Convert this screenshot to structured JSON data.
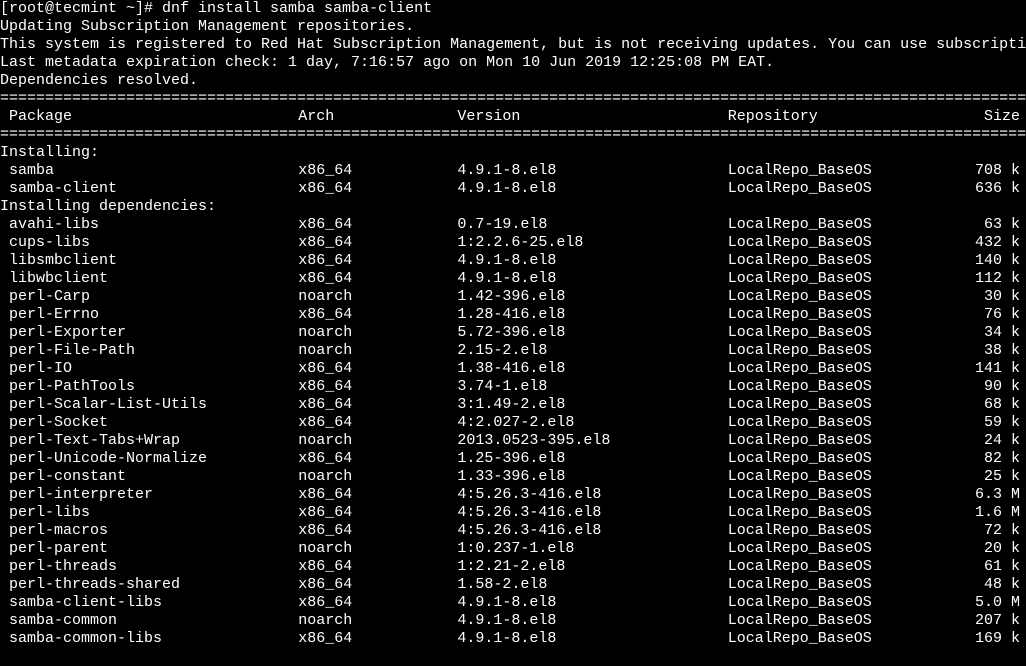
{
  "prompt_prefix": "[root@tecmint ~]# ",
  "command": "dnf install samba samba-client",
  "messages": [
    "Updating Subscription Management repositories.",
    "This system is registered to Red Hat Subscription Management, but is not receiving updates. You can use subscription-manager to assign subscriptions.",
    "Last metadata expiration check: 1 day, 7:16:57 ago on Mon 10 Jun 2019 12:25:08 PM EAT.",
    "Dependencies resolved."
  ],
  "ruler": "==================================================================================================================",
  "headers": {
    "package": " Package",
    "arch": "Arch",
    "version": "Version",
    "repository": "Repository",
    "size": "Size"
  },
  "sections": [
    {
      "title": "Installing:",
      "rows": [
        {
          "pkg": " samba",
          "arch": "x86_64",
          "ver": "4.9.1-8.el8",
          "repo": "LocalRepo_BaseOS",
          "size": "708 k"
        },
        {
          "pkg": " samba-client",
          "arch": "x86_64",
          "ver": "4.9.1-8.el8",
          "repo": "LocalRepo_BaseOS",
          "size": "636 k"
        }
      ]
    },
    {
      "title": "Installing dependencies:",
      "rows": [
        {
          "pkg": " avahi-libs",
          "arch": "x86_64",
          "ver": "0.7-19.el8",
          "repo": "LocalRepo_BaseOS",
          "size": "63 k"
        },
        {
          "pkg": " cups-libs",
          "arch": "x86_64",
          "ver": "1:2.2.6-25.el8",
          "repo": "LocalRepo_BaseOS",
          "size": "432 k"
        },
        {
          "pkg": " libsmbclient",
          "arch": "x86_64",
          "ver": "4.9.1-8.el8",
          "repo": "LocalRepo_BaseOS",
          "size": "140 k"
        },
        {
          "pkg": " libwbclient",
          "arch": "x86_64",
          "ver": "4.9.1-8.el8",
          "repo": "LocalRepo_BaseOS",
          "size": "112 k"
        },
        {
          "pkg": " perl-Carp",
          "arch": "noarch",
          "ver": "1.42-396.el8",
          "repo": "LocalRepo_BaseOS",
          "size": "30 k"
        },
        {
          "pkg": " perl-Errno",
          "arch": "x86_64",
          "ver": "1.28-416.el8",
          "repo": "LocalRepo_BaseOS",
          "size": "76 k"
        },
        {
          "pkg": " perl-Exporter",
          "arch": "noarch",
          "ver": "5.72-396.el8",
          "repo": "LocalRepo_BaseOS",
          "size": "34 k"
        },
        {
          "pkg": " perl-File-Path",
          "arch": "noarch",
          "ver": "2.15-2.el8",
          "repo": "LocalRepo_BaseOS",
          "size": "38 k"
        },
        {
          "pkg": " perl-IO",
          "arch": "x86_64",
          "ver": "1.38-416.el8",
          "repo": "LocalRepo_BaseOS",
          "size": "141 k"
        },
        {
          "pkg": " perl-PathTools",
          "arch": "x86_64",
          "ver": "3.74-1.el8",
          "repo": "LocalRepo_BaseOS",
          "size": "90 k"
        },
        {
          "pkg": " perl-Scalar-List-Utils",
          "arch": "x86_64",
          "ver": "3:1.49-2.el8",
          "repo": "LocalRepo_BaseOS",
          "size": "68 k"
        },
        {
          "pkg": " perl-Socket",
          "arch": "x86_64",
          "ver": "4:2.027-2.el8",
          "repo": "LocalRepo_BaseOS",
          "size": "59 k"
        },
        {
          "pkg": " perl-Text-Tabs+Wrap",
          "arch": "noarch",
          "ver": "2013.0523-395.el8",
          "repo": "LocalRepo_BaseOS",
          "size": "24 k"
        },
        {
          "pkg": " perl-Unicode-Normalize",
          "arch": "x86_64",
          "ver": "1.25-396.el8",
          "repo": "LocalRepo_BaseOS",
          "size": "82 k"
        },
        {
          "pkg": " perl-constant",
          "arch": "noarch",
          "ver": "1.33-396.el8",
          "repo": "LocalRepo_BaseOS",
          "size": "25 k"
        },
        {
          "pkg": " perl-interpreter",
          "arch": "x86_64",
          "ver": "4:5.26.3-416.el8",
          "repo": "LocalRepo_BaseOS",
          "size": "6.3 M"
        },
        {
          "pkg": " perl-libs",
          "arch": "x86_64",
          "ver": "4:5.26.3-416.el8",
          "repo": "LocalRepo_BaseOS",
          "size": "1.6 M"
        },
        {
          "pkg": " perl-macros",
          "arch": "x86_64",
          "ver": "4:5.26.3-416.el8",
          "repo": "LocalRepo_BaseOS",
          "size": "72 k"
        },
        {
          "pkg": " perl-parent",
          "arch": "noarch",
          "ver": "1:0.237-1.el8",
          "repo": "LocalRepo_BaseOS",
          "size": "20 k"
        },
        {
          "pkg": " perl-threads",
          "arch": "x86_64",
          "ver": "1:2.21-2.el8",
          "repo": "LocalRepo_BaseOS",
          "size": "61 k"
        },
        {
          "pkg": " perl-threads-shared",
          "arch": "x86_64",
          "ver": "1.58-2.el8",
          "repo": "LocalRepo_BaseOS",
          "size": "48 k"
        },
        {
          "pkg": " samba-client-libs",
          "arch": "x86_64",
          "ver": "4.9.1-8.el8",
          "repo": "LocalRepo_BaseOS",
          "size": "5.0 M"
        },
        {
          "pkg": " samba-common",
          "arch": "noarch",
          "ver": "4.9.1-8.el8",
          "repo": "LocalRepo_BaseOS",
          "size": "207 k"
        },
        {
          "pkg": " samba-common-libs",
          "arch": "x86_64",
          "ver": "4.9.1-8.el8",
          "repo": "LocalRepo_BaseOS",
          "size": "169 k"
        }
      ]
    }
  ]
}
